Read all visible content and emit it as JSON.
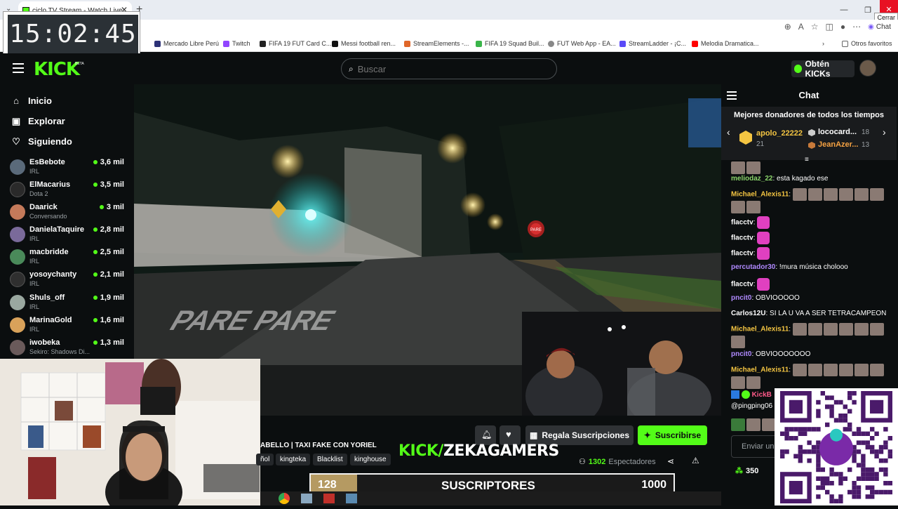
{
  "clock": {
    "time": "15:02:45"
  },
  "browser": {
    "tab_title": "ciclo TV Stream - Watch Live o...",
    "tooltip": "Cerrar",
    "chat_button": "Chat",
    "bookmarks": [
      "Mercado Libre Perú",
      "Twitch",
      "FIFA 19 FUT Card C...",
      "Messi football ren...",
      "StreamElements -...",
      "FIFA 19 Squad Buil...",
      "FUT Web App - EA...",
      "StreamLadder - ¡C...",
      "Melodia Dramatica...",
      "Otros favoritos"
    ]
  },
  "kick": {
    "logo": "KICK",
    "beta": "BETA",
    "search_placeholder": "Buscar",
    "obten_kicks": "Obtén KICKs"
  },
  "sidebar": {
    "nav": [
      "Inicio",
      "Explorar",
      "Siguiendo"
    ],
    "channels": [
      {
        "name": "EsBebote",
        "category": "IRL",
        "viewers": "3,6 mil",
        "color": "#5a6a7a"
      },
      {
        "name": "ElMacarius",
        "category": "Dota 2",
        "viewers": "3,5 mil",
        "color": "#2a2a2a"
      },
      {
        "name": "Daarick",
        "category": "Conversando",
        "viewers": "3 mil",
        "color": "#c47a5a"
      },
      {
        "name": "DanielaTaquire",
        "category": "IRL",
        "viewers": "2,8 mil",
        "color": "#7a6a9a"
      },
      {
        "name": "macbridde",
        "category": "IRL",
        "viewers": "2,5 mil",
        "color": "#4a8a5a"
      },
      {
        "name": "yosoychanty",
        "category": "IRL",
        "viewers": "2,1 mil",
        "color": "#2f2f2f"
      },
      {
        "name": "Shuls_off",
        "category": "IRL",
        "viewers": "1,9 mil",
        "color": "#9aa8a0"
      },
      {
        "name": "MarinaGold",
        "category": "IRL",
        "viewers": "1,6 mil",
        "color": "#d9a25a"
      },
      {
        "name": "iwobeka",
        "category": "Sekiro: Shadows Di...",
        "viewers": "1,3 mil",
        "color": "#6a5a5a"
      }
    ]
  },
  "stream": {
    "title": "ABELLO | TAXI FAKE CON YORIEL",
    "tags": [
      "ñol",
      "kingteka",
      "Blacklist",
      "kinghouse"
    ],
    "channel_prefix": "KICK/",
    "channel_name": "ZEKAGAMERS",
    "viewers": "1302",
    "viewers_label": "Espectadores",
    "regala": "Regala Suscripciones",
    "suscribirse": "Suscribirse",
    "road_text": "PARE PARE",
    "sign_text": "PARE"
  },
  "sub_goal": {
    "current": "128",
    "label": "SUSCRIPTORES",
    "goal": "1000",
    "progress_fraction": 0.128
  },
  "chat": {
    "title": "Chat",
    "donors_title": "Mejores donadores de todos los tiempos",
    "donors": [
      {
        "name": "apolo_22222",
        "count": "21"
      },
      {
        "name": "lococard...",
        "count": "18"
      },
      {
        "name": "JeanAzer...",
        "count": "13"
      }
    ],
    "messages": [
      {
        "user": "meliodaz_22",
        "color": "#8ad46a",
        "text": "esta kagado ese"
      },
      {
        "user": "Michael_Alexis11",
        "color": "#f4c542",
        "text": ""
      },
      {
        "user": "flacctv",
        "color": "#ffffff",
        "text": ""
      },
      {
        "user": "flacctv",
        "color": "#ffffff",
        "text": ""
      },
      {
        "user": "flacctv",
        "color": "#ffffff",
        "text": ""
      },
      {
        "user": "percutador30",
        "color": "#b08aff",
        "text": "!mura música cholooo"
      },
      {
        "user": "flacctv",
        "color": "#ffffff",
        "text": ""
      },
      {
        "user": "pncit0",
        "color": "#b08aff",
        "text": "OBVIOOOOO"
      },
      {
        "user": "Carlos12U",
        "color": "#ffffff",
        "text": "SI LA U VA A SER TETRACAMPEON"
      },
      {
        "user": "Michael_Alexis11",
        "color": "#f4c542",
        "text": ""
      },
      {
        "user": "pncit0",
        "color": "#b08aff",
        "text": "OBVIOOOOOOO"
      },
      {
        "user": "Michael_Alexis11",
        "color": "#f4c542",
        "text": ""
      },
      {
        "user": "KickB",
        "color": "#ff5a8a",
        "text": ""
      },
      {
        "user": "",
        "color": "#ffffff",
        "text": "@pingping06"
      }
    ],
    "input_placeholder": "Enviar un",
    "points": "350"
  },
  "colors": {
    "kick_green": "#53fc18",
    "bg": "#0b0e0f"
  }
}
